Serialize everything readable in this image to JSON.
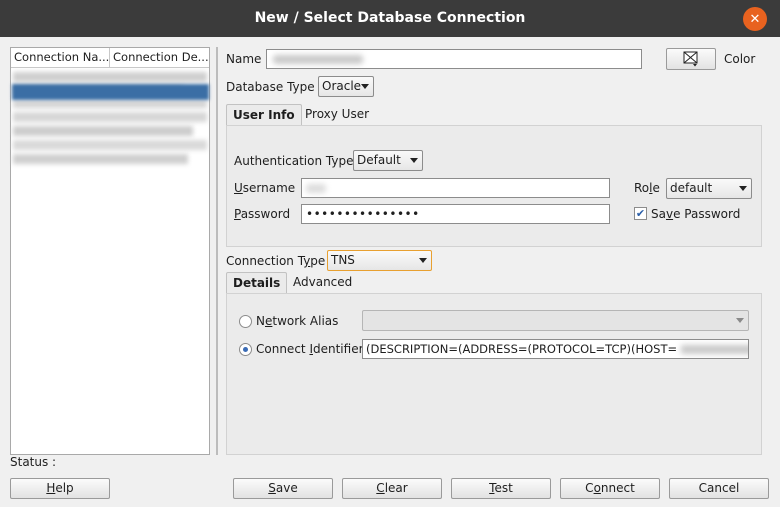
{
  "window": {
    "title": "New / Select Database Connection",
    "close_icon": "close-icon"
  },
  "connection_list": {
    "columns": [
      "Connection Na...",
      "Connection De..."
    ],
    "selected_row_color": "#3b6ea5"
  },
  "form": {
    "name_label": "Name",
    "color_label": "Color",
    "database_type_label": "Database Type",
    "database_type_value": "Oracle",
    "tabs": [
      "User Info",
      "Proxy User"
    ],
    "auth_type_label": "Authentication Type",
    "auth_type_value": "Default",
    "username_label": "Username",
    "password_label": "Password",
    "password_value": "•••••••••••••••",
    "role_label": "Role",
    "role_value": "default",
    "save_password_label": "Save Password",
    "save_password_checked": true,
    "connection_type_label": "Connection Type",
    "connection_type_value": "TNS",
    "detail_tabs": [
      "Details",
      "Advanced"
    ],
    "network_alias_label": "Network Alias",
    "connect_identifier_label": "Connect Identifier",
    "connect_identifier_value": "(DESCRIPTION=(ADDRESS=(PROTOCOL=TCP)(HOST="
  },
  "status": {
    "label": "Status :"
  },
  "buttons": {
    "help": "Help",
    "save": "Save",
    "clear": "Clear",
    "test": "Test",
    "connect": "Connect",
    "cancel": "Cancel"
  }
}
